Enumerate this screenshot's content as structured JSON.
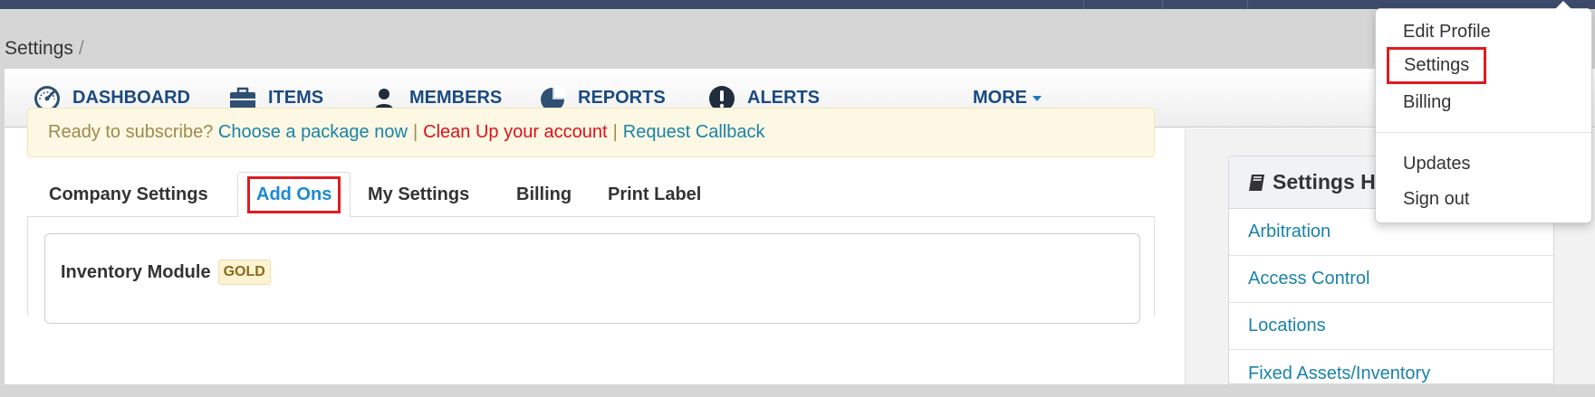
{
  "breadcrumb": {
    "current": "Settings",
    "separator": "/"
  },
  "nav": {
    "items": [
      {
        "label": "DASHBOARD",
        "icon": "dashboard-gauge-icon"
      },
      {
        "label": "ITEMS",
        "icon": "briefcase-icon"
      },
      {
        "label": "MEMBERS",
        "icon": "user-icon"
      },
      {
        "label": "REPORTS",
        "icon": "pie-chart-icon"
      },
      {
        "label": "ALERTS",
        "icon": "exclamation-icon"
      },
      {
        "label": "MORE",
        "icon": "caret-down-icon"
      }
    ]
  },
  "alert": {
    "prompt": "Ready to subscribe?",
    "choose_link": "Choose a package now",
    "pipe": "|",
    "cleanup_link": "Clean Up your account",
    "callback_link": "Request Callback"
  },
  "tabs": [
    {
      "label": "Company Settings"
    },
    {
      "label": "Add Ons",
      "active": true
    },
    {
      "label": "My Settings"
    },
    {
      "label": "Billing"
    },
    {
      "label": "Print Label"
    }
  ],
  "module": {
    "title": "Inventory Module",
    "badge": "GOLD"
  },
  "help": {
    "title": "Settings H",
    "items": [
      "Arbitration",
      "Access Control",
      "Locations",
      "Fixed Assets/Inventory"
    ]
  },
  "dropdown": {
    "items": [
      "Edit Profile",
      "Settings",
      "Billing",
      "Updates",
      "Sign out"
    ]
  },
  "colors": {
    "nav_text": "#1b4a80",
    "link": "#1a83a8",
    "highlight_box": "#e01b22",
    "topbar": "#3c4a6b"
  }
}
